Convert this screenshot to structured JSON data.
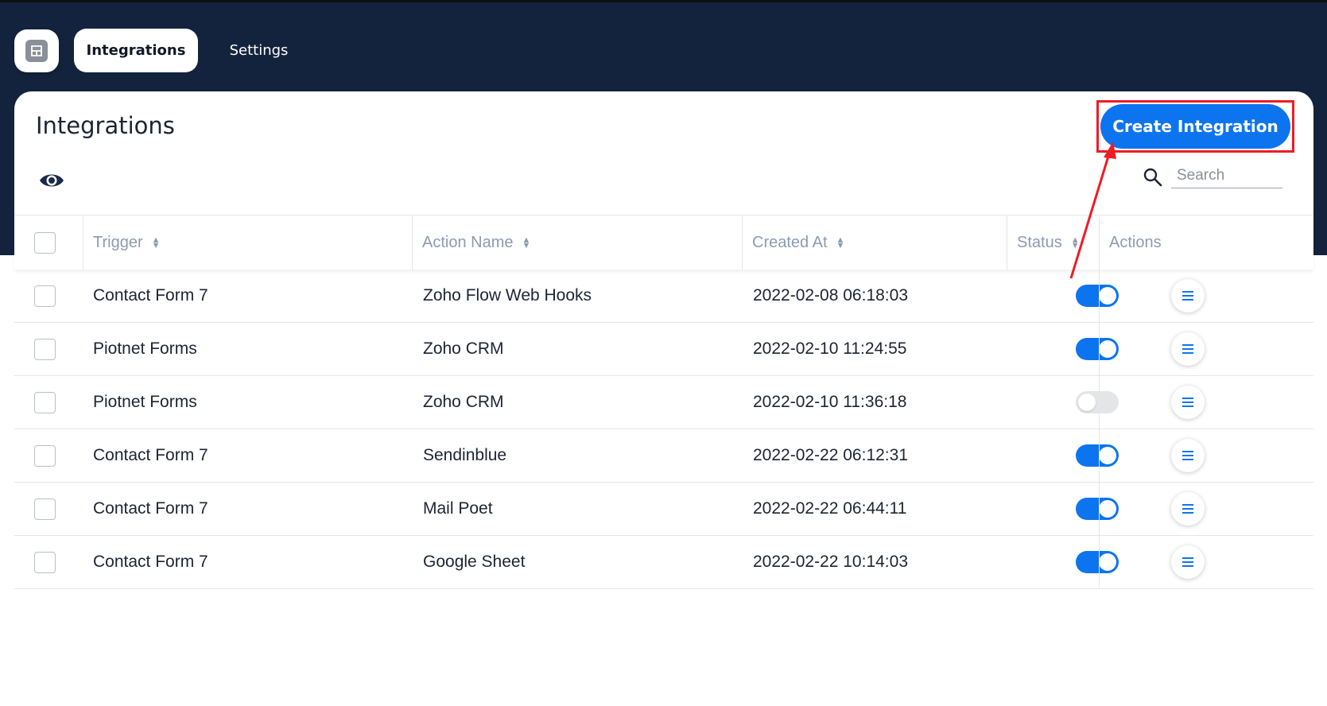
{
  "nav": {
    "tabs": [
      {
        "label": "Integrations",
        "active": true
      },
      {
        "label": "Settings",
        "active": false
      }
    ]
  },
  "page": {
    "title": "Integrations",
    "create_button_label": "Create Integration",
    "search_placeholder": "Search"
  },
  "table": {
    "columns": [
      "Trigger",
      "Action Name",
      "Created At",
      "Status",
      "Actions"
    ],
    "rows": [
      {
        "trigger": "Contact Form 7",
        "action_name": "Zoho Flow Web Hooks",
        "created_at": "2022-02-08 06:18:03",
        "status": true
      },
      {
        "trigger": "Piotnet Forms",
        "action_name": "Zoho CRM",
        "created_at": "2022-02-10 11:24:55",
        "status": true
      },
      {
        "trigger": "Piotnet Forms",
        "action_name": "Zoho CRM",
        "created_at": "2022-02-10 11:36:18",
        "status": false
      },
      {
        "trigger": "Contact Form 7",
        "action_name": "Sendinblue",
        "created_at": "2022-02-22 06:12:31",
        "status": true
      },
      {
        "trigger": "Contact Form 7",
        "action_name": "Mail Poet",
        "created_at": "2022-02-22 06:44:11",
        "status": true
      },
      {
        "trigger": "Contact Form 7",
        "action_name": "Google Sheet",
        "created_at": "2022-02-22 10:14:03",
        "status": true
      }
    ]
  },
  "colors": {
    "header_bg": "#14233d",
    "accent": "#0d74f0",
    "annotation": "#ee1c25"
  },
  "icons": [
    "app-logo-icon",
    "eye-icon",
    "search-icon",
    "sort-icon",
    "menu-lines-icon"
  ]
}
